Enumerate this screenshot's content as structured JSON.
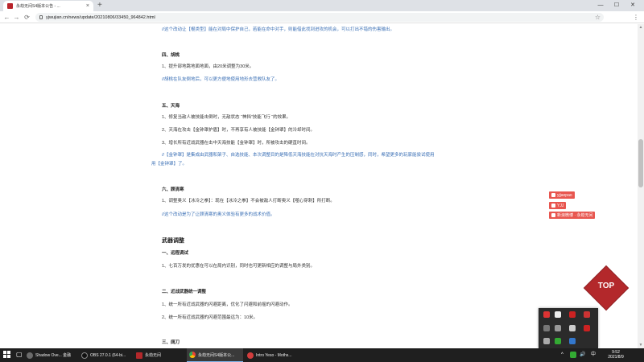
{
  "browser": {
    "tab_title": "永劫无间S4版本公告 - ...",
    "tab_close": "×",
    "new_tab": "+",
    "url": "yjwujian.cn/news/update/20210806/33450_964842.html",
    "minimize": "—",
    "maximize": "☐",
    "close": "✕",
    "back": "←",
    "forward": "→",
    "reload": "⟳",
    "home": "⌂",
    "star": "☆",
    "menu": "⋮"
  },
  "article": {
    "p1": "//这个改动让【棍类型】能在对局中保护自己，若能在命中对手，则能借此找到进攻的机会，可以打出不错的伤害输出。",
    "h_four": "四、胡桃",
    "four_1": "1、提升部地跳地面地面，由20米调整为30米。",
    "four_note": "//胡桃在队友倒地后，可以更方便地使用地形去营救队友了。",
    "h_five": "五、天海",
    "five_1": "1、修复当敌人被技能击倒时，无敌状态 “神挡”技能飞行 “的效果。",
    "five_2": "2、天海在攻击【金钟罩护盾】时，不再享有人被技能【金钟罩】的冷却时间。",
    "five_3": "3、增长所有近战武器在击中天海技能【金钟罩】时，所被攻击的硬直时间。",
    "five_note_1": "//【金钟罩】是集成由武器和架子、自选技能、本次调整目的是降低天海技能在对抗天海时产生的压制感，同时，希望更多的玩家能尝试使用",
    "five_note_2": "用【金钟罩】了。",
    "h_six": "六、顾清寒",
    "six_1": "1、调整奥义【冰冷之拳】：现在【冰冷之拳】不会被敌人打断奥义【噬心穿刺】所打断。",
    "six_note": "//这个改动是为了让顾清寒的奥义体验有更多的战术价值。",
    "h_weapons": "武器调整",
    "w_one": "一、远程调试",
    "w_one_1": "1、七百万发的优惠在可以在局内识别，同时也可更新相应的调整与局外类别。",
    "w_two": "二、近战武器统一调整",
    "w_two_1": "1、统一所有近战武器的闪避距离，优化了闪避和前摇的闪避动作。",
    "w_two_2": "2、统一所有近战武器的闪避范围最远为：10米。",
    "w_three": "三、阔刀"
  },
  "badges": [
    {
      "label": "yjjaopao",
      "icon": "douyin-icon"
    },
    {
      "label": "YJJ",
      "icon": "tiktok-icon"
    },
    {
      "label": "新浪微博 · 永劫无间",
      "icon": "weibo-icon"
    }
  ],
  "top_button": "TOP",
  "taskbar": {
    "apps": [
      {
        "label": "Shadow Ove... 金融",
        "color": "#6b6b6b"
      },
      {
        "label": "OBS 27.0.1 (64-bi...",
        "color": "#222222"
      },
      {
        "label": "永劫无间",
        "color": "#b3282b"
      },
      {
        "label": "永劫无间S4版本公...",
        "color": "#e8a33a"
      },
      {
        "label": "Intro Yeso - Moths...",
        "color": "#d33d3d"
      }
    ],
    "sys_up": "^",
    "sys_vol": "🔊",
    "sys_ime": "中",
    "time": "9:52",
    "date": "2021/8/9"
  },
  "colors": {
    "accent": "#b3282b",
    "link_blue": "#3a6fb5",
    "badge": "#e8564f"
  }
}
